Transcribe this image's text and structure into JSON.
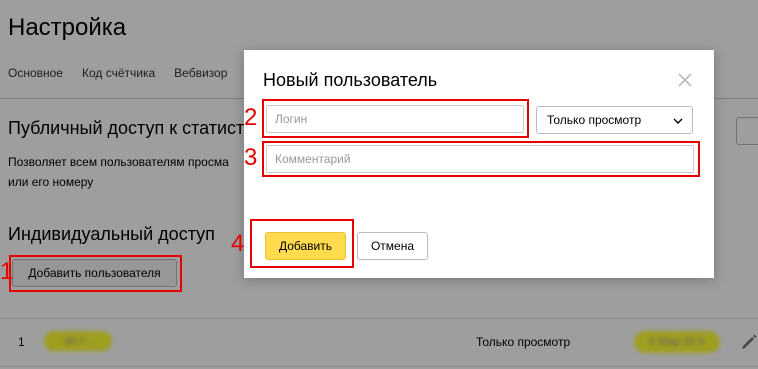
{
  "page": {
    "title": "Настройка",
    "tabs": [
      "Основное",
      "Код счётчика",
      "Вебвизор"
    ],
    "public_access_title": "Публичный доступ к статист",
    "public_access_desc_line1": "Позволяет всем пользователям просма",
    "public_access_desc_line2": "или его номеру",
    "individual_access_title": "Индивидуальный доступ",
    "add_user_button": "Добавить пользователя",
    "row": {
      "number": "1",
      "login_blurred": "ah l... ",
      "access": "Только просмотр",
      "date_blurred": "0 Мар 20 5"
    }
  },
  "modal": {
    "title": "Новый пользователь",
    "login_placeholder": "Логин",
    "login_value": "",
    "role_selected": "Только просмотр",
    "comment_placeholder": "Комментарий",
    "comment_value": "",
    "add_button": "Добавить",
    "cancel_button": "Отмена"
  },
  "annotations": {
    "labels": [
      "1",
      "2",
      "3",
      "4"
    ],
    "color": "#e60000"
  },
  "colors": {
    "primary_button": "#ffdb4d",
    "annotation": "#e60000",
    "overlay": "rgba(0,0,0,0.38)"
  }
}
